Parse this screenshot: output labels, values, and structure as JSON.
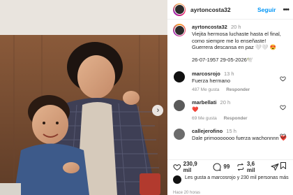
{
  "header": {
    "username": "ayrtoncosta32",
    "follow_label": "Seguir",
    "more_icon": "•••"
  },
  "caption": {
    "username": "ayrtoncosta32",
    "time": "20 h",
    "text": "Viejita hermosa luchaste hasta el final, como siempre me lo enseñaste! Guerrera descansa en paz 🤍🤍 😍",
    "dates": "26-07-1957  29-05-2026🕊️"
  },
  "comments": [
    {
      "username": "marcosrojo",
      "time": "13 h",
      "text": "Fuerza hermano",
      "likes": "487 Me gusta",
      "reply": "Responder"
    },
    {
      "username": "marbellati",
      "time": "20 h",
      "text": "❤️",
      "likes": "69 Me gusta",
      "reply": "Responder"
    },
    {
      "username": "callejerofino",
      "time": "15 h",
      "text": "Dale primooooooo fuerza wachonnnn ❤️",
      "likes": "",
      "reply": ""
    }
  ],
  "actions": {
    "likes_count": "230,9 mil",
    "comments_count": "99",
    "shares_count": "3,6 mil"
  },
  "liked_by": "Les gusta a marcosrojo y 230 mil personas más",
  "posted_ago": "Hace 20 horas",
  "carousel_next": "›",
  "icons": [
    "heart-icon",
    "comment-icon",
    "repost-icon",
    "send-icon",
    "bookmark-icon",
    "chevron-right-icon"
  ]
}
